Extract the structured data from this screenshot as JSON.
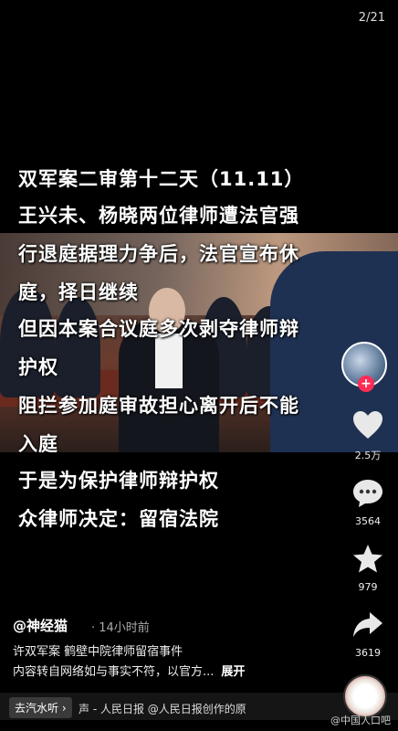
{
  "page_counter": "2/21",
  "captions": [
    "双军案二审第十二天（11.11）",
    "王兴未、杨晓两位律师遭法官强",
    "行退庭据理力争后，法官宣布休",
    "庭，择日继续",
    "但因本案合议庭多次剥夺律师辩",
    "护权",
    "阻拦参加庭审故担心离开后不能",
    "入庭",
    "于是为保护律师辩护权",
    "众律师决定：留宿法院"
  ],
  "rail": {
    "like_count": "2.5万",
    "comment_count": "3564",
    "favorite_count": "979",
    "share_count": "3619",
    "follow_plus": "+"
  },
  "post": {
    "author": "@神经猫",
    "time": "· 14小时前",
    "line1": "许双军案 鹤壁中院律师留宿事件",
    "line2": "内容转自网络如与事实不符，以官方...",
    "expand": "展开"
  },
  "bottom": {
    "chip": "去汽水听 ›",
    "music": "声 - 人民日报    @人民日报创作的原",
    "watermark": "@中国人口吧"
  },
  "colors": {
    "accent": "#fe2c55",
    "background": "#000000"
  }
}
